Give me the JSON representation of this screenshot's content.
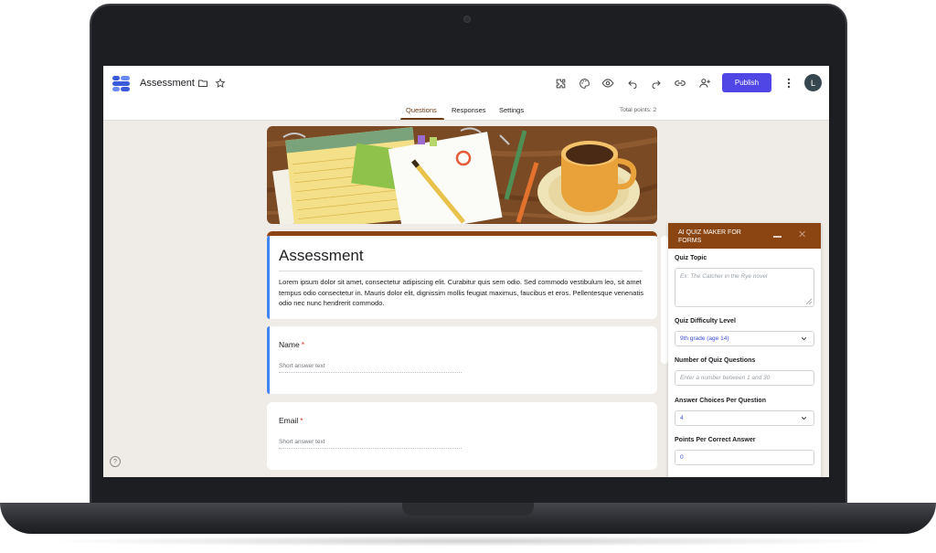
{
  "app": {
    "doc_title": "Assessment",
    "publish_label": "Publish",
    "avatar_initial": "L",
    "accent_color": "#4f46e5",
    "brand_color": "#8a4512"
  },
  "toolbar_icons": [
    "addon-icon",
    "palette-icon",
    "preview-eye-icon",
    "undo-icon",
    "redo-icon",
    "link-icon",
    "add-collaborator-icon"
  ],
  "tabs": {
    "questions": "Questions",
    "responses": "Responses",
    "settings": "Settings",
    "active": "Questions"
  },
  "total_points": "Total points: 2",
  "form": {
    "title": "Assessment",
    "description": "Lorem ipsum dolor sit amet, consectetur adipiscing elit. Curabitur quis sem odio. Sed commodo vestibulum leo, sit amet tempus odio consectetur in. Mauris dolor elit, dignissim mollis feugiat maximus, faucibus et eros. Pellentesque venenatis odio nec nunc hendrerit commodo.",
    "questions": [
      {
        "label": "Name",
        "required_mark": "*",
        "placeholder": "Short answer text"
      },
      {
        "label": "Email",
        "required_mark": "*",
        "placeholder": "Short answer text"
      }
    ]
  },
  "panel": {
    "title": "AI QUIZ MAKER FOR FORMS",
    "topic_label": "Quiz Topic",
    "topic_placeholder": "Ex: The Catcher in the Rye novel",
    "difficulty_label": "Quiz Difficulty Level",
    "difficulty_value": "9th grade (age 14)",
    "num_questions_label": "Number of Quiz Questions",
    "num_questions_placeholder": "Enter a number between 1 and 30",
    "choices_label": "Answer Choices Per Question",
    "choices_value": "4",
    "points_label": "Points Per Correct Answer",
    "points_value": "0"
  },
  "help_glyph": "?"
}
